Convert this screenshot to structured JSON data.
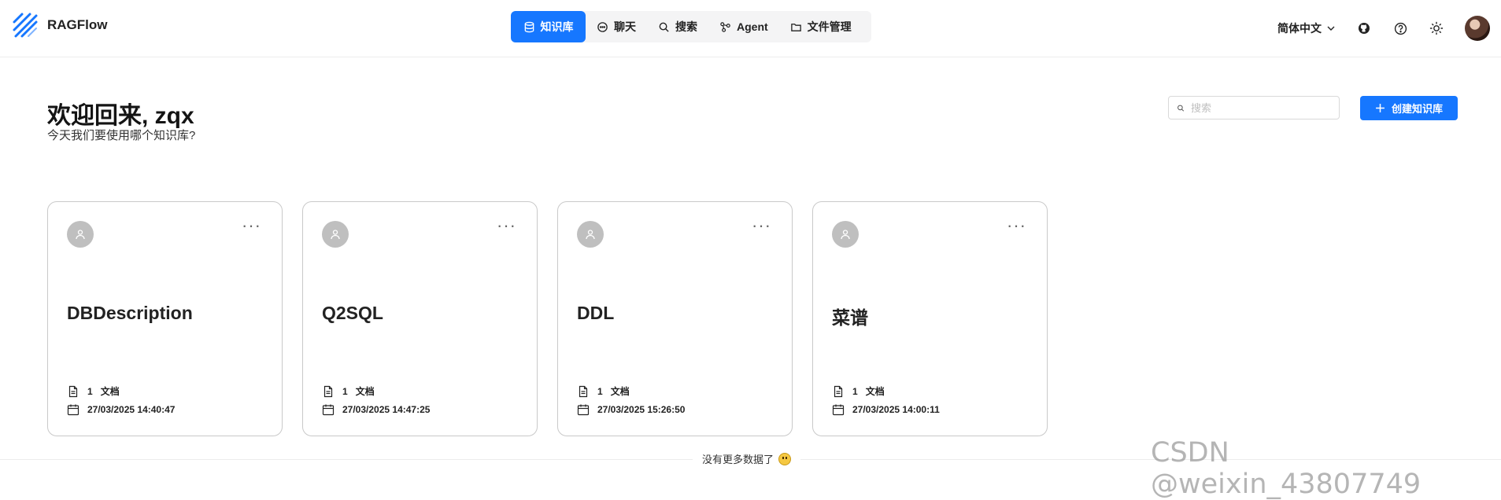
{
  "header": {
    "app_name": "RAGFlow",
    "nav": [
      {
        "label": "知识库",
        "icon": "database-icon",
        "active": true
      },
      {
        "label": "聊天",
        "icon": "chat-icon",
        "active": false
      },
      {
        "label": "搜索",
        "icon": "search-icon",
        "active": false
      },
      {
        "label": "Agent",
        "icon": "agent-graph-icon",
        "active": false
      },
      {
        "label": "文件管理",
        "icon": "folder-icon",
        "active": false
      }
    ],
    "language": "简体中文",
    "icons": [
      "github-icon",
      "help-icon",
      "theme-sun-icon",
      "user-avatar"
    ]
  },
  "main": {
    "welcome": "欢迎回来, zqx",
    "subtitle": "今天我们要使用哪个知识库?",
    "search_placeholder": "搜索",
    "create_label": "创建知识库"
  },
  "cards": [
    {
      "title": "DBDescription",
      "doc_count": "1",
      "doc_unit": "文档",
      "date": "27/03/2025 14:40:47"
    },
    {
      "title": "Q2SQL",
      "doc_count": "1",
      "doc_unit": "文档",
      "date": "27/03/2025 14:47:25"
    },
    {
      "title": "DDL",
      "doc_count": "1",
      "doc_unit": "文档",
      "date": "27/03/2025 15:26:50"
    },
    {
      "title": "菜谱",
      "doc_count": "1",
      "doc_unit": "文档",
      "date": "27/03/2025 14:00:11"
    }
  ],
  "footer": {
    "no_more": "没有更多数据了"
  },
  "watermark": "CSDN @weixin_43807749",
  "colors": {
    "accent": "#1677ff",
    "card_border": "#c9c9c9"
  }
}
